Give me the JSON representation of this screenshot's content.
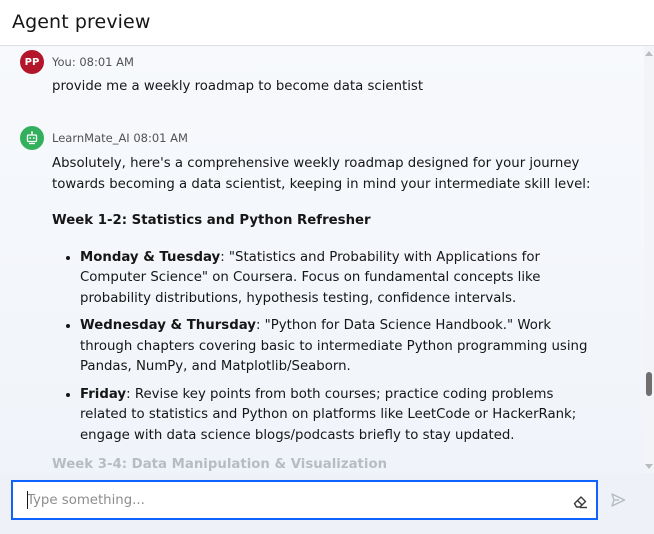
{
  "header": {
    "title": "Agent preview"
  },
  "messages": {
    "user": {
      "avatar_initials": "PP",
      "meta": "You: 08:01 AM",
      "text": "provide me a weekly roadmap to become data scientist"
    },
    "bot": {
      "meta": "LearnMate_AI 08:01 AM",
      "intro": "Absolutely, here's a comprehensive weekly roadmap designed for your journey towards becoming a data scientist, keeping in mind your intermediate skill level:",
      "week1_heading": "Week 1-2: Statistics and Python Refresher",
      "items": [
        {
          "label": "Monday & Tuesday",
          "text": ": \"Statistics and Probability with Applications for Computer Science\" on Coursera. Focus on fundamental concepts like probability distributions, hypothesis testing, confidence intervals."
        },
        {
          "label": "Wednesday & Thursday",
          "text": ": \"Python for Data Science Handbook.\" Work through chapters covering basic to intermediate Python programming using Pandas, NumPy, and Matplotlib/Seaborn."
        },
        {
          "label": "Friday",
          "text": ": Revise key points from both courses; practice coding problems related to statistics and Python on platforms like LeetCode or HackerRank; engage with data science blogs/podcasts briefly to stay updated."
        }
      ],
      "week3_heading": "Week 3-4: Data Manipulation & Visualization"
    }
  },
  "input": {
    "placeholder": "Type something...",
    "value": ""
  },
  "icons": {
    "user_avatar": "user-avatar",
    "bot_avatar": "robot-icon",
    "clear": "eraser-icon",
    "send": "send-icon"
  },
  "colors": {
    "accent": "#0f62fe",
    "user_avatar": "#b3152a",
    "bot_avatar": "#33b05c"
  }
}
